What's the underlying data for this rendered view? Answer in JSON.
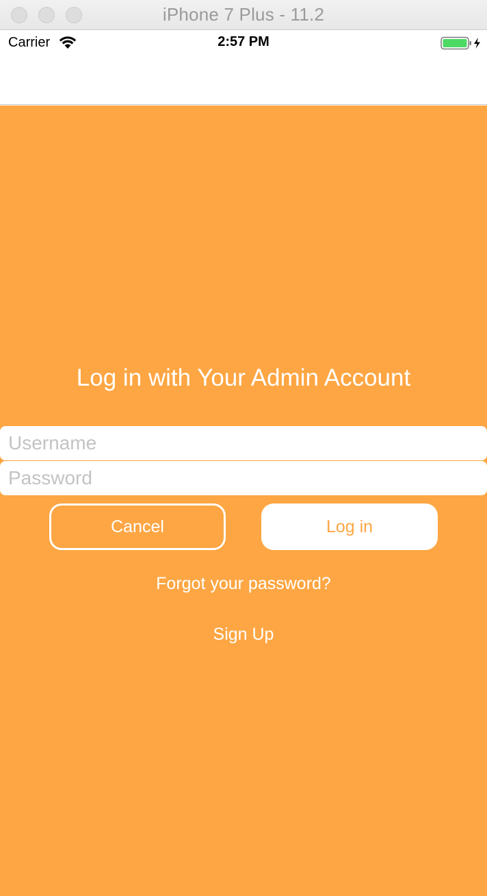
{
  "window": {
    "title": "iPhone 7 Plus - 11.2"
  },
  "status_bar": {
    "carrier": "Carrier",
    "time": "2:57 PM",
    "icons": [
      "wifi-icon",
      "battery-charging-icon"
    ]
  },
  "login": {
    "heading": "Log in with Your Admin Account",
    "username_placeholder": "Username",
    "username_value": "",
    "password_placeholder": "Password",
    "password_value": "",
    "cancel_label": "Cancel",
    "login_label": "Log in",
    "forgot_label": "Forgot your password?",
    "signup_label": "Sign Up"
  },
  "colors": {
    "accent": "#fda643",
    "battery_fill": "#4cd964"
  }
}
